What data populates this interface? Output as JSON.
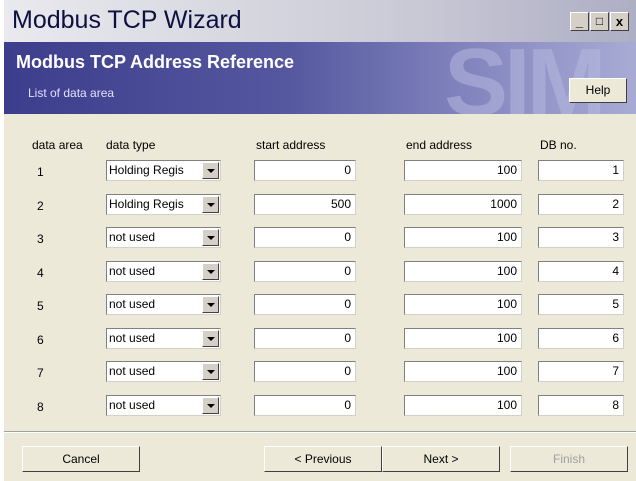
{
  "window": {
    "title": "Modbus TCP Wizard",
    "minimize": "_",
    "maximize": "□",
    "close": "x"
  },
  "header": {
    "title": "Modbus TCP Address Reference",
    "subtitle": "List of data area",
    "watermark": "SIM",
    "help_label": "Help"
  },
  "table": {
    "columns": [
      "data area",
      "data type",
      "start address",
      "end address",
      "DB no."
    ],
    "rows": [
      {
        "area": "1",
        "type": "Holding Regis",
        "start": "0",
        "end": "100",
        "db": "1"
      },
      {
        "area": "2",
        "type": "Holding Regis",
        "start": "500",
        "end": "1000",
        "db": "2"
      },
      {
        "area": "3",
        "type": "not used",
        "start": "0",
        "end": "100",
        "db": "3"
      },
      {
        "area": "4",
        "type": "not used",
        "start": "0",
        "end": "100",
        "db": "4"
      },
      {
        "area": "5",
        "type": "not used",
        "start": "0",
        "end": "100",
        "db": "5"
      },
      {
        "area": "6",
        "type": "not used",
        "start": "0",
        "end": "100",
        "db": "6"
      },
      {
        "area": "7",
        "type": "not used",
        "start": "0",
        "end": "100",
        "db": "7"
      },
      {
        "area": "8",
        "type": "not used",
        "start": "0",
        "end": "100",
        "db": "8"
      }
    ]
  },
  "footer": {
    "cancel": "Cancel",
    "previous": "< Previous",
    "next": "Next >",
    "finish": "Finish"
  },
  "colors": {
    "banner_dark": "#3c3d8c",
    "title_text": "#0e1140",
    "dialog_bg": "#ece9d8"
  }
}
